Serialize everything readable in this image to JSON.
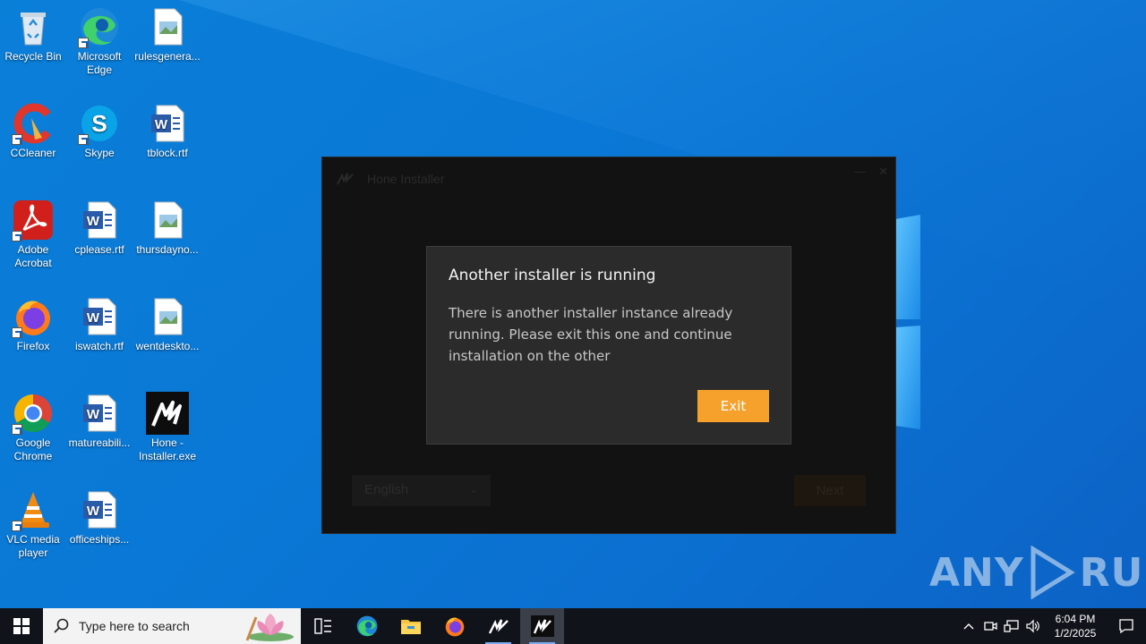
{
  "desktop": {
    "icons": [
      {
        "label": "Recycle Bin",
        "icon": "recycle-bin-icon"
      },
      {
        "label": "Microsoft Edge",
        "icon": "edge-icon"
      },
      {
        "label": "rulesgenera...",
        "icon": "image-file-icon"
      },
      {
        "label": "CCleaner",
        "icon": "ccleaner-icon"
      },
      {
        "label": "Skype",
        "icon": "skype-icon"
      },
      {
        "label": "tblock.rtf",
        "icon": "word-document-icon"
      },
      {
        "label": "Adobe Acrobat",
        "icon": "acrobat-icon"
      },
      {
        "label": "cplease.rtf",
        "icon": "word-document-icon"
      },
      {
        "label": "thursdayno...",
        "icon": "image-file-icon"
      },
      {
        "label": "Firefox",
        "icon": "firefox-icon"
      },
      {
        "label": "iswatch.rtf",
        "icon": "word-document-icon"
      },
      {
        "label": "wentdeskto...",
        "icon": "image-file-icon"
      },
      {
        "label": "Google Chrome",
        "icon": "chrome-icon"
      },
      {
        "label": "matureabili...",
        "icon": "word-document-icon"
      },
      {
        "label": "Hone - Installer.exe",
        "icon": "hone-icon"
      },
      {
        "label": "VLC media player",
        "icon": "vlc-icon"
      },
      {
        "label": "officeships...",
        "icon": "word-document-icon"
      }
    ]
  },
  "installer": {
    "title": "Hone Installer",
    "language": "English",
    "next_label": "Next"
  },
  "dialog": {
    "title": "Another installer is running",
    "message": "There is another installer instance already running. Please exit this one and continue installation on the other",
    "exit_label": "Exit"
  },
  "watermark": {
    "text_left": "ANY",
    "text_right": "RUN"
  },
  "taskbar": {
    "search_placeholder": "Type here to search",
    "apps": [
      "task-view-icon",
      "edge-icon",
      "file-explorer-icon",
      "firefox-icon",
      "hone-icon",
      "hone-icon"
    ],
    "clock_time": "6:04 PM",
    "clock_date": "1/2/2025"
  },
  "colors": {
    "accent": "#f6a12b",
    "dialog_bg": "#2b2b2b",
    "installer_bg": "#121212",
    "taskbar_bg": "#10131a"
  }
}
